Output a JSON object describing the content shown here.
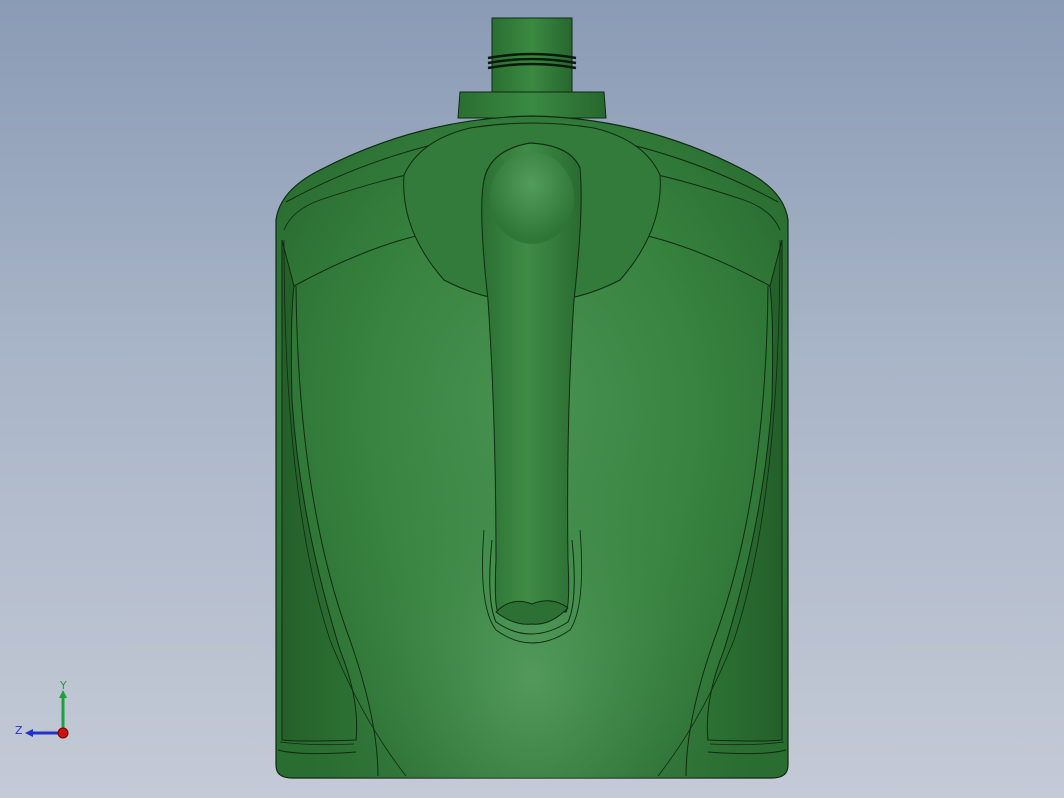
{
  "viewport": {
    "background_top": "#8a9bb5",
    "background_bottom": "#c4cad6"
  },
  "model": {
    "body_color": "#2f7a36",
    "edge_color": "#0f2a12",
    "highlight_color": "#4d9656"
  },
  "triad": {
    "y_label": "Y",
    "z_label": "Z",
    "y_color": "#1aa33a",
    "z_color": "#2233cc",
    "x_color": "#cc1111"
  }
}
